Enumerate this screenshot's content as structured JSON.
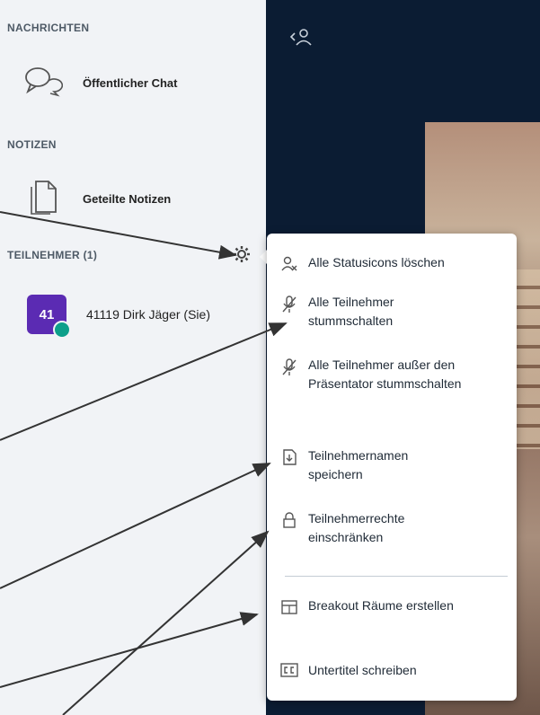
{
  "sidebar": {
    "messages": {
      "section_label": "NACHRICHTEN",
      "public_chat_label": "Öffentlicher Chat"
    },
    "notes": {
      "section_label": "NOTIZEN",
      "shared_notes_label": "Geteilte Notizen"
    },
    "participants": {
      "section_label": "TEILNEHMER (1)",
      "user_initials": "41",
      "user_name": "41119 Dirk Jäger (Sie)"
    }
  },
  "menu": {
    "items": [
      {
        "label": "Alle Statusicons löschen",
        "icon": "clear-status-icon"
      },
      {
        "label": "Alle Teilnehmer stummschalten",
        "icon": "mute-icon"
      },
      {
        "label": "Alle Teilnehmer außer den Präsentator stummschalten",
        "icon": "mute-except-presenter-icon"
      },
      {
        "label": "Teilnehmernamen speichern",
        "icon": "save-file-icon"
      },
      {
        "label": "Teilnehmerrechte einschränken",
        "icon": "lock-icon"
      },
      {
        "label": "Breakout Räume erstellen",
        "icon": "breakout-rooms-icon"
      },
      {
        "label": "Untertitel schreiben",
        "icon": "closed-captions-icon"
      }
    ]
  },
  "colors": {
    "sidebar_bg": "#f1f3f6",
    "main_bg": "#0b1c33",
    "avatar": "#5b2bb3",
    "badge": "#0d9f8a"
  }
}
